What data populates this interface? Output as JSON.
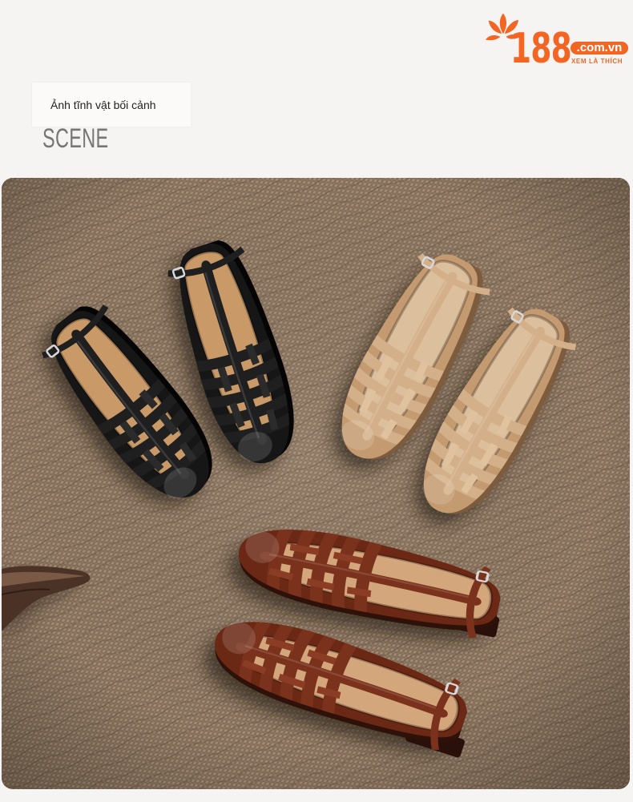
{
  "colors": {
    "accent": "#f26522",
    "page_background": "#f6f4f2"
  },
  "brand": {
    "icon": "flower-icon",
    "number": "188",
    "domain": ".com.vn",
    "tagline": "XEM LÀ THÍCH"
  },
  "section": {
    "caption": "Ảnh tĩnh vật bối cảnh",
    "heading": "SCENE"
  }
}
